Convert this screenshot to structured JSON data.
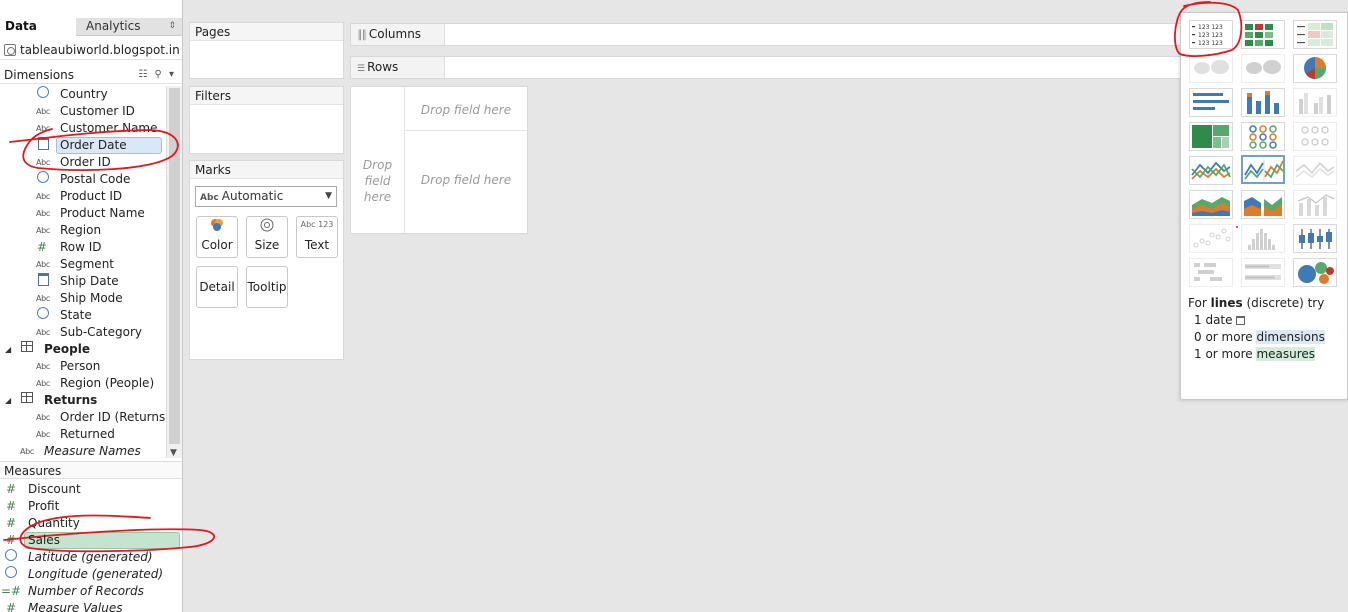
{
  "tabs": {
    "data": "Data",
    "analytics": "Analytics"
  },
  "data_source": "tableaubiworld.blogspot.in",
  "dimensions": {
    "header": "Dimensions",
    "items": [
      {
        "label": "Country",
        "icon": "globe-icon"
      },
      {
        "label": "Customer ID",
        "icon": "abc-icon"
      },
      {
        "label": "Customer Name",
        "icon": "abc-icon"
      },
      {
        "label": "Order Date",
        "icon": "calendar-icon",
        "selected": true
      },
      {
        "label": "Order ID",
        "icon": "abc-icon"
      },
      {
        "label": "Postal Code",
        "icon": "globe-icon"
      },
      {
        "label": "Product ID",
        "icon": "abc-icon"
      },
      {
        "label": "Product Name",
        "icon": "abc-icon"
      },
      {
        "label": "Region",
        "icon": "abc-icon"
      },
      {
        "label": "Row ID",
        "icon": "hash-icon"
      },
      {
        "label": "Segment",
        "icon": "abc-icon"
      },
      {
        "label": "Ship Date",
        "icon": "calendar-icon"
      },
      {
        "label": "Ship Mode",
        "icon": "abc-icon"
      },
      {
        "label": "State",
        "icon": "globe-icon"
      },
      {
        "label": "Sub-Category",
        "icon": "abc-icon"
      }
    ],
    "groups": [
      {
        "label": "People",
        "items": [
          "Person",
          "Region (People)"
        ]
      },
      {
        "label": "Returns",
        "items": [
          "Order ID (Returns)",
          "Returned"
        ]
      }
    ],
    "measure_names": "Measure Names"
  },
  "measures": {
    "header": "Measures",
    "items": [
      {
        "label": "Discount",
        "icon": "hash-icon"
      },
      {
        "label": "Profit",
        "icon": "hash-icon"
      },
      {
        "label": "Quantity",
        "icon": "hash-icon"
      },
      {
        "label": "Sales",
        "icon": "hash-icon",
        "selected": true
      },
      {
        "label": "Latitude (generated)",
        "icon": "globe-icon"
      },
      {
        "label": "Longitude (generated)",
        "icon": "globe-icon"
      },
      {
        "label": "Number of Records",
        "icon": "hash-icon"
      },
      {
        "label": "Measure Values",
        "icon": "hash-icon"
      }
    ]
  },
  "cards": {
    "pages": "Pages",
    "filters": "Filters",
    "marks": "Marks",
    "mark_type": "Automatic",
    "buttons": {
      "color": "Color",
      "size": "Size",
      "text": "Text",
      "detail": "Detail",
      "tooltip": "Tooltip"
    },
    "text_glyph": "Abc 123"
  },
  "shelves": {
    "columns": "Columns",
    "rows": "Rows"
  },
  "view": {
    "drop_field": "Drop field here",
    "drop_field_left": "Drop field here"
  },
  "show_me": {
    "hint_prefix": "For",
    "hint_bold": "lines",
    "hint_suffix": "(discrete) try",
    "req1": "1 date",
    "req2_prefix": "0 or more",
    "req2_hl": "dimensions",
    "req3_prefix": "1 or more",
    "req3_hl": "measures"
  },
  "colors": {
    "annotation": "#e8151b",
    "dimension_pill": "#d9e7f7",
    "measure_pill": "#c4e4cf",
    "active_thumb": "#6f9fd8"
  }
}
